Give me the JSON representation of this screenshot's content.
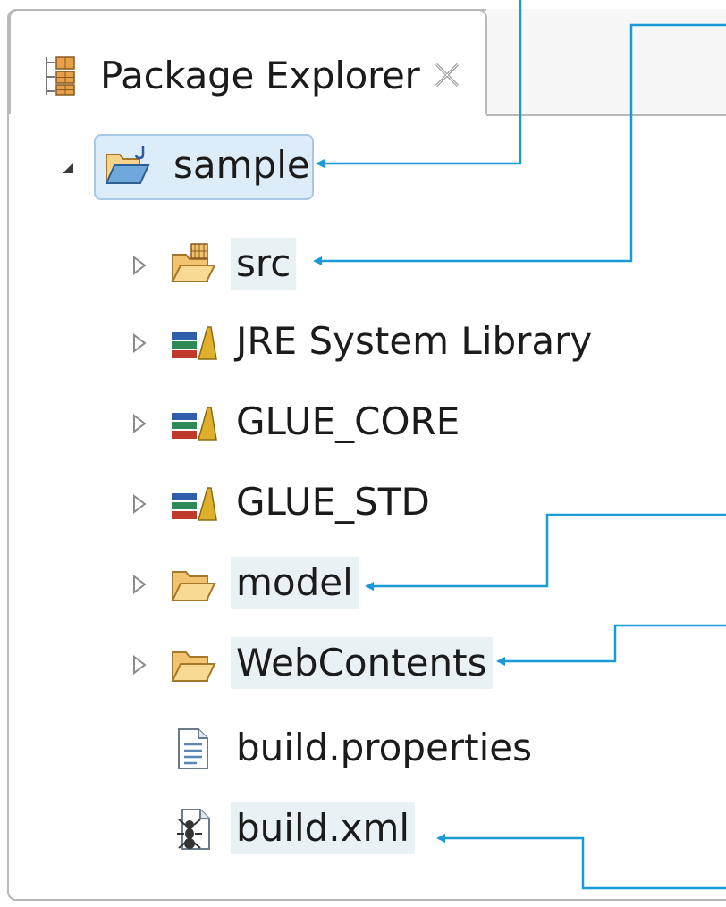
{
  "view": {
    "title": "Package Explorer",
    "tab_icon": "package-explorer-icon",
    "close_icon": "close-icon"
  },
  "tree": {
    "items": [
      {
        "label": "sample",
        "icon": "java-project-icon",
        "expand": "expanded",
        "selected": true
      },
      {
        "label": "src",
        "icon": "source-folder-icon",
        "expand": "collapsed"
      },
      {
        "label": "JRE System Library",
        "icon": "library-icon",
        "expand": "collapsed"
      },
      {
        "label": "GLUE_CORE",
        "icon": "library-icon",
        "expand": "collapsed"
      },
      {
        "label": "GLUE_STD",
        "icon": "library-icon",
        "expand": "collapsed"
      },
      {
        "label": "model",
        "icon": "folder-icon",
        "expand": "collapsed"
      },
      {
        "label": "WebContents",
        "icon": "folder-icon",
        "expand": "collapsed"
      },
      {
        "label": "build.properties",
        "icon": "properties-file-icon",
        "expand": "none"
      },
      {
        "label": "build.xml",
        "icon": "ant-file-icon",
        "expand": "none"
      }
    ]
  },
  "colors": {
    "callout_line": "#1a9ad6",
    "selection_bg": "#dcecf8",
    "highlight_bg": "#e9f1f5",
    "folder": "#f2c46f"
  }
}
